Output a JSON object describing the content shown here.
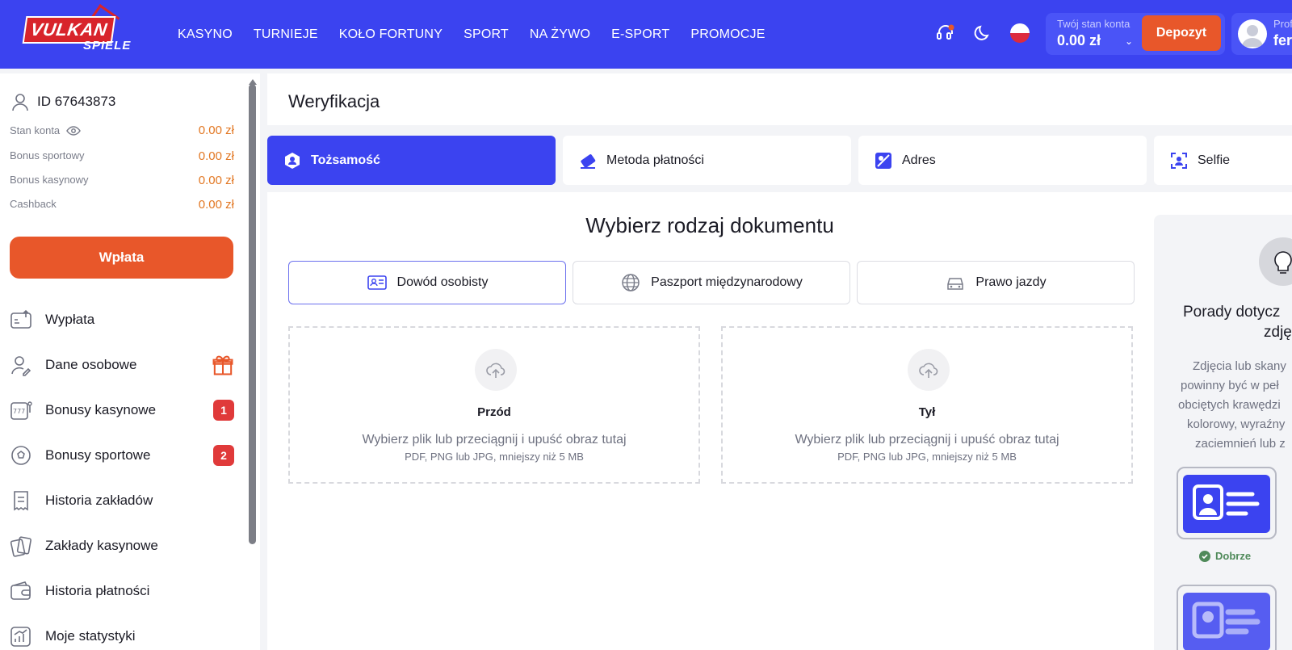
{
  "header": {
    "logo_main": "VULKAN",
    "logo_sub": "SPIELE",
    "nav": [
      "KASYNO",
      "TURNIEJE",
      "KOŁO FORTUNY",
      "SPORT",
      "NA ŻYWO",
      "E-SPORT",
      "PROMOCJE"
    ],
    "balance_label": "Twój stan konta",
    "balance_value": "0.00 zł",
    "deposit_label": "Depozyt",
    "profile_label": "Prof",
    "profile_name": "fer",
    "icons": [
      "support-headset-icon",
      "moon-icon",
      "poland-flag-icon"
    ]
  },
  "sidebar": {
    "user_id": "ID 67643873",
    "stats": [
      {
        "label": "Stan konta",
        "value": "0.00 zł"
      },
      {
        "label": "Bonus sportowy",
        "value": "0.00 zł"
      },
      {
        "label": "Bonus kasynowy",
        "value": "0.00 zł"
      },
      {
        "label": "Cashback",
        "value": "0.00 zł"
      }
    ],
    "wplata_label": "Wpłata",
    "menu": [
      {
        "label": "Wypłata",
        "icon": "withdraw-icon"
      },
      {
        "label": "Dane osobowe",
        "icon": "user-edit-icon"
      },
      {
        "label": "Bonusy kasynowe",
        "icon": "slot-machine-icon",
        "badge": "1"
      },
      {
        "label": "Bonusy sportowe",
        "icon": "football-icon",
        "badge": "2"
      },
      {
        "label": "Historia zakładów",
        "icon": "receipt-icon"
      },
      {
        "label": "Zakłady kasynowe",
        "icon": "cards-icon"
      },
      {
        "label": "Historia płatności",
        "icon": "wallet-icon"
      },
      {
        "label": "Moje statystyki",
        "icon": "stats-icon"
      }
    ]
  },
  "main": {
    "title": "Weryfikacja",
    "tabs": [
      {
        "label": "Tożsamość",
        "icon": "identity-icon"
      },
      {
        "label": "Metoda płatności",
        "icon": "card-icon"
      },
      {
        "label": "Adres",
        "icon": "map-icon"
      },
      {
        "label": "Selfie",
        "icon": "selfie-icon"
      }
    ],
    "doc_heading": "Wybierz rodzaj dokumentu",
    "doc_types": [
      "Dowód osobisty",
      "Paszport międzynarodowy",
      "Prawo jazdy"
    ],
    "uploads": [
      {
        "title": "Przód",
        "desc": "Wybierz plik lub przeciągnij i upuść obraz tutaj",
        "hint": "PDF, PNG lub JPG, mniejszy niż 5 MB"
      },
      {
        "title": "Tył",
        "desc": "Wybierz plik lub przeciągnij i upuść obraz tutaj",
        "hint": "PDF, PNG lub JPG, mniejszy niż 5 MB"
      }
    ],
    "tips": {
      "title_line1": "Porady dotycz",
      "title_line2": "zdję",
      "text_lines": [
        "Zdjęcia lub skany",
        "powinny być w peł",
        "obciętych krawędzi",
        "kolorowy, wyraźny",
        "zaciemnień lub z"
      ],
      "good_label": "Dobrze"
    }
  },
  "colors": {
    "brand": "#3b43f0",
    "accent": "#e8572a",
    "money": "#e27722",
    "badge": "#e03a3a"
  }
}
